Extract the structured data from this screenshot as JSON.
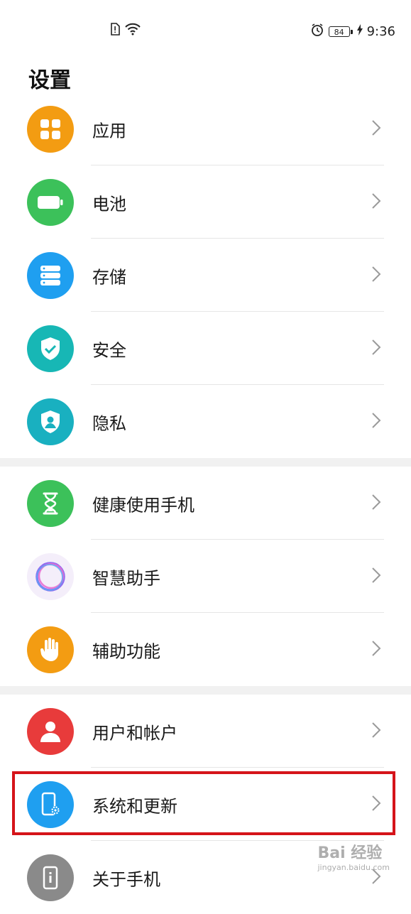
{
  "status_bar": {
    "time": "9:36",
    "battery_level": "84",
    "icons": [
      "sim-alert-icon",
      "wifi-icon",
      "alarm-icon",
      "battery-icon",
      "charging-icon"
    ]
  },
  "page": {
    "title": "设置"
  },
  "groups": [
    {
      "items": [
        {
          "label": "应用",
          "icon": "apps-icon",
          "color": "#f39c12"
        },
        {
          "label": "电池",
          "icon": "battery-icon",
          "color": "#3cc15a"
        },
        {
          "label": "存储",
          "icon": "storage-icon",
          "color": "#1f9ff0"
        },
        {
          "label": "安全",
          "icon": "shield-check-icon",
          "color": "#17b7b5"
        },
        {
          "label": "隐私",
          "icon": "privacy-shield-icon",
          "color": "#19b0c0"
        }
      ]
    },
    {
      "items": [
        {
          "label": "健康使用手机",
          "icon": "hourglass-icon",
          "color": "#3cc15a"
        },
        {
          "label": "智慧助手",
          "icon": "assistant-ring-icon",
          "color": "#f4eefa"
        },
        {
          "label": "辅助功能",
          "icon": "hand-icon",
          "color": "#f39c12"
        }
      ]
    },
    {
      "items": [
        {
          "label": "用户和帐户",
          "icon": "user-icon",
          "color": "#e83b3b"
        },
        {
          "label": "系统和更新",
          "icon": "phone-settings-icon",
          "color": "#1f9ff0"
        },
        {
          "label": "关于手机",
          "icon": "phone-info-icon",
          "color": "#8a8a8a"
        }
      ]
    }
  ],
  "highlight_color": "#d5141a",
  "watermark": {
    "brand": "Bai 经验",
    "url": "jingyan.baidu.com"
  }
}
